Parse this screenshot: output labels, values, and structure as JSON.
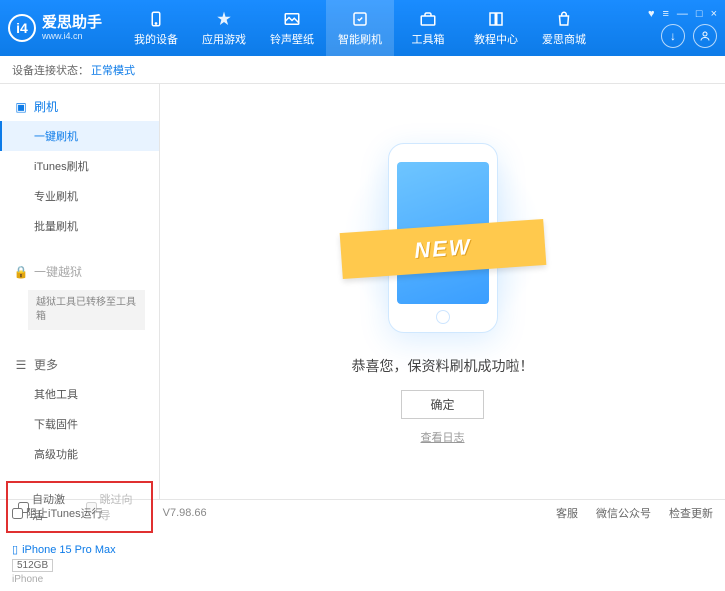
{
  "header": {
    "app_name": "爱思助手",
    "url": "www.i4.cn",
    "nav": [
      {
        "label": "我的设备"
      },
      {
        "label": "应用游戏"
      },
      {
        "label": "铃声壁纸"
      },
      {
        "label": "智能刷机"
      },
      {
        "label": "工具箱"
      },
      {
        "label": "教程中心"
      },
      {
        "label": "爱思商城"
      }
    ],
    "win": {
      "gift": "♥",
      "menu": "≡",
      "min": "—",
      "max": "□",
      "close": "×"
    }
  },
  "status": {
    "label": "设备连接状态：",
    "value": "正常模式"
  },
  "sidebar": {
    "flash": {
      "title": "刷机",
      "items": [
        "一键刷机",
        "iTunes刷机",
        "专业刷机",
        "批量刷机"
      ]
    },
    "jailbreak": {
      "title": "一键越狱",
      "note": "越狱工具已转移至工具箱"
    },
    "more": {
      "title": "更多",
      "items": [
        "其他工具",
        "下载固件",
        "高级功能"
      ]
    },
    "checks": {
      "auto_activate": "自动激活",
      "skip_guide": "跳过向导"
    },
    "device": {
      "name": "iPhone 15 Pro Max",
      "storage": "512GB",
      "type": "iPhone"
    }
  },
  "main": {
    "ribbon": "NEW",
    "success": "恭喜您，保资料刷机成功啦！",
    "ok": "确定",
    "log": "查看日志"
  },
  "footer": {
    "block_itunes": "阻止iTunes运行",
    "version": "V7.98.66",
    "links": [
      "客服",
      "微信公众号",
      "检查更新"
    ]
  }
}
